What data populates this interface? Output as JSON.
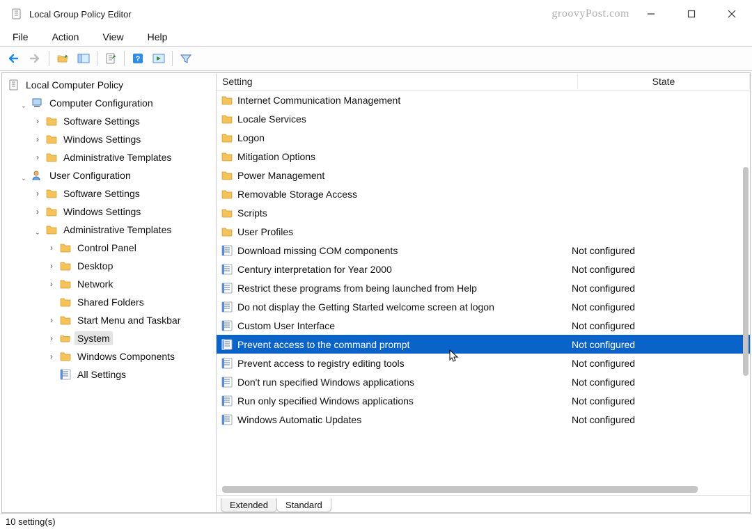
{
  "window": {
    "title": "Local Group Policy Editor",
    "watermark": "groovyPost.com"
  },
  "menu": {
    "file": "File",
    "action": "Action",
    "view": "View",
    "help": "Help"
  },
  "tree": {
    "root": "Local Computer Policy",
    "cc": "Computer Configuration",
    "cc_sw": "Software Settings",
    "cc_ws": "Windows Settings",
    "cc_at": "Administrative Templates",
    "uc": "User Configuration",
    "uc_sw": "Software Settings",
    "uc_ws": "Windows Settings",
    "uc_at": "Administrative Templates",
    "at_cp": "Control Panel",
    "at_dk": "Desktop",
    "at_nw": "Network",
    "at_sf": "Shared Folders",
    "at_sm": "Start Menu and Taskbar",
    "at_sy": "System",
    "at_wc": "Windows Components",
    "at_as": "All Settings"
  },
  "columns": {
    "setting": "Setting",
    "state": "State"
  },
  "state_not_configured": "Not configured",
  "folders": [
    "Internet Communication Management",
    "Locale Services",
    "Logon",
    "Mitigation Options",
    "Power Management",
    "Removable Storage Access",
    "Scripts",
    "User Profiles"
  ],
  "settings": [
    {
      "label": "Download missing COM components"
    },
    {
      "label": "Century interpretation for Year 2000"
    },
    {
      "label": "Restrict these programs from being launched from Help"
    },
    {
      "label": "Do not display the Getting Started welcome screen at logon"
    },
    {
      "label": "Custom User Interface"
    },
    {
      "label": "Prevent access to the command prompt",
      "selected": true
    },
    {
      "label": "Prevent access to registry editing tools"
    },
    {
      "label": "Don't run specified Windows applications"
    },
    {
      "label": "Run only specified Windows applications"
    },
    {
      "label": "Windows Automatic Updates"
    }
  ],
  "tabs": {
    "extended": "Extended",
    "standard": "Standard"
  },
  "status": "10 setting(s)"
}
